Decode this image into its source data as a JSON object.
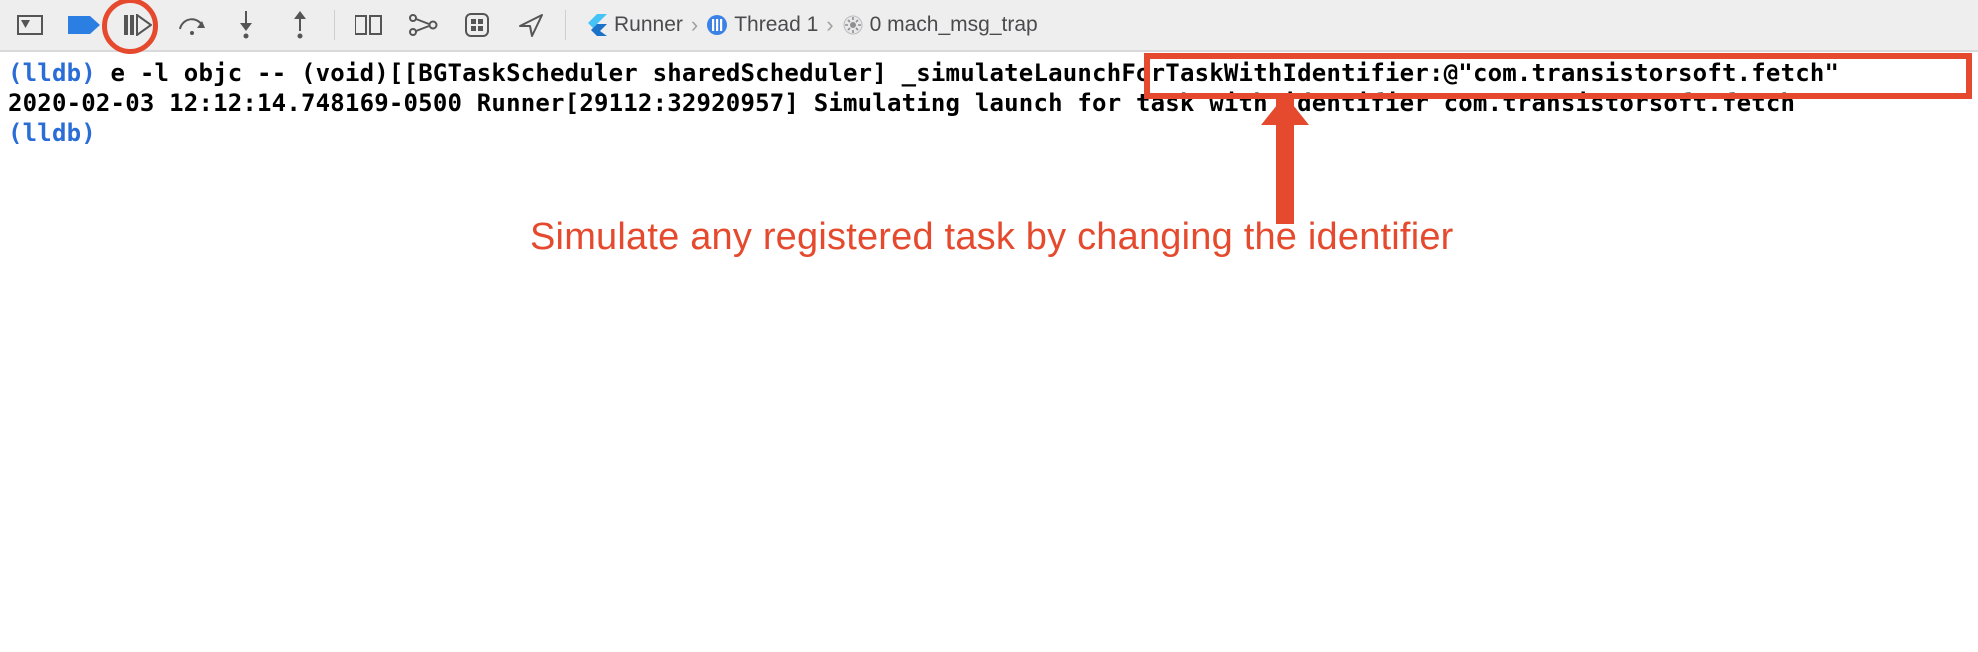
{
  "toolbar": {
    "icons": {
      "console_toggle": "console-toggle-icon",
      "breakpoint": "breakpoint-icon",
      "continue": "continue-icon",
      "step_over": "step-over-icon",
      "step_into": "step-into-icon",
      "step_out": "step-out-icon",
      "view_debug": "view-debug-icon",
      "memory_graph": "memory-graph-icon",
      "environment": "environment-overrides-icon",
      "location": "simulate-location-icon"
    }
  },
  "breadcrumb": {
    "items": [
      {
        "icon": "flutter-icon",
        "label": "Runner"
      },
      {
        "icon": "thread-icon",
        "label": "Thread 1"
      },
      {
        "icon": "frame-icon",
        "label": "0 mach_msg_trap"
      }
    ]
  },
  "console": {
    "prompt": "(lldb)",
    "cmd_pre": " e -l objc -- (void)[[BGTaskScheduler sharedScheduler] _simulateLaunchForTaskWithIdentifier:@\"",
    "cmd_highlight": "com.transistorsoft.fetch",
    "cmd_post": "\"",
    "log_line": "2020-02-03 12:12:14.748169-0500 Runner[29112:32920957] Simulating launch for task with identifier com.transistorsoft.fetch"
  },
  "annotations": {
    "main_callout": "Simulate any registered task by changing the identifier"
  }
}
